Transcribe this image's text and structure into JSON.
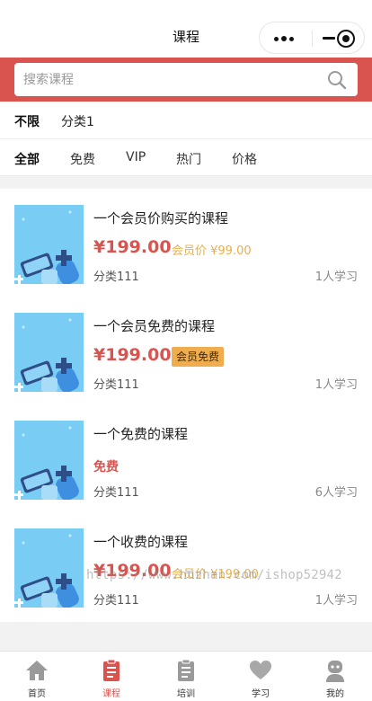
{
  "nav": {
    "title": "课程"
  },
  "search": {
    "placeholder": "搜索课程"
  },
  "categories": [
    {
      "label": "不限",
      "active": true
    },
    {
      "label": "分类1",
      "active": false
    }
  ],
  "filters": [
    {
      "label": "全部",
      "active": true
    },
    {
      "label": "免费",
      "active": false
    },
    {
      "label": "VIP",
      "active": false
    },
    {
      "label": "热门",
      "active": false
    },
    {
      "label": "价格",
      "active": false
    }
  ],
  "courses": [
    {
      "title": "一个会员价购买的课程",
      "price": "¥199.00",
      "member_price": "会员价 ¥99.00",
      "category": "分类111",
      "learners": "1人学习"
    },
    {
      "title": "一个会员免费的课程",
      "price": "¥199.00",
      "member_badge": "会员免费",
      "category": "分类111",
      "learners": "1人学习"
    },
    {
      "title": "一个免费的课程",
      "free_label": "免费",
      "category": "分类111",
      "learners": "6人学习"
    },
    {
      "title": "一个收费的课程",
      "price": "¥199.00",
      "member_price": "会员价 ¥199.00",
      "category": "分类111",
      "learners": "1人学习"
    }
  ],
  "watermark": "https://www.huzhan.com/ishop52942",
  "tabs": [
    {
      "label": "首页",
      "icon": "home-icon",
      "active": false
    },
    {
      "label": "课程",
      "icon": "course-icon",
      "active": true
    },
    {
      "label": "培训",
      "icon": "training-icon",
      "active": false
    },
    {
      "label": "学习",
      "icon": "heart-icon",
      "active": false
    },
    {
      "label": "我的",
      "icon": "profile-icon",
      "active": false
    }
  ],
  "colors": {
    "accent": "#d9534f",
    "member": "#e8b04a",
    "badge": "#f0ad4e",
    "thumb": "#79cdf5"
  }
}
